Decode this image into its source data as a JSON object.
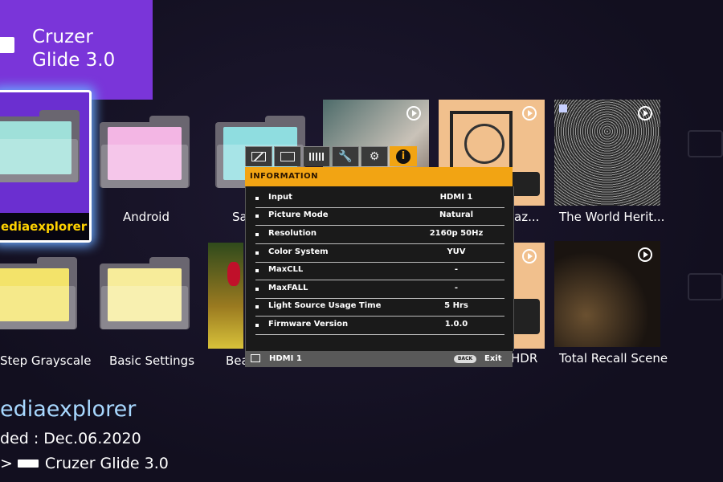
{
  "usb_panel": {
    "title": "Cruzer Glide 3.0"
  },
  "tiles_row1": [
    {
      "label": "ediaexplorer"
    },
    {
      "label": "Android"
    },
    {
      "label": "Sa"
    },
    {
      "label": ""
    },
    {
      "label": "az..."
    },
    {
      "label": "The World Herit..."
    }
  ],
  "tiles_row2": [
    {
      "label": "Step Grayscale"
    },
    {
      "label": "Basic Settings"
    },
    {
      "label": "Bea"
    },
    {
      "label": "HDR"
    },
    {
      "label": "Total Recall Scene"
    }
  ],
  "osd": {
    "header": "INFORMATION",
    "tabs": [
      "picture-icon",
      "display-icon",
      "keyboard-icon",
      "wrench-icon",
      "wrench-gear-icon",
      "info-icon"
    ],
    "info_symbol": "i",
    "rows": [
      {
        "label": "Input",
        "value": "HDMI 1"
      },
      {
        "label": "Picture Mode",
        "value": "Natural"
      },
      {
        "label": "Resolution",
        "value": "2160p 50Hz"
      },
      {
        "label": "Color System",
        "value": "YUV"
      },
      {
        "label": "MaxCLL",
        "value": "-"
      },
      {
        "label": "MaxFALL",
        "value": "-"
      },
      {
        "label": "Light Source Usage Time",
        "value": "5 Hrs"
      },
      {
        "label": "Firmware Version",
        "value": "1.0.0"
      }
    ],
    "footer": {
      "source": "HDMI 1",
      "back": "BACK",
      "exit": "Exit"
    }
  },
  "bottom": {
    "title": "ediaexplorer",
    "date": "ded : Dec.06.2020",
    "path_prefix": ">",
    "path": "Cruzer Glide 3.0"
  },
  "colors": {
    "accent_purple": "#7a35d9",
    "osd_orange": "#f2a413",
    "selected_label": "#ffd200",
    "bottom_title": "#a8d8ff"
  }
}
